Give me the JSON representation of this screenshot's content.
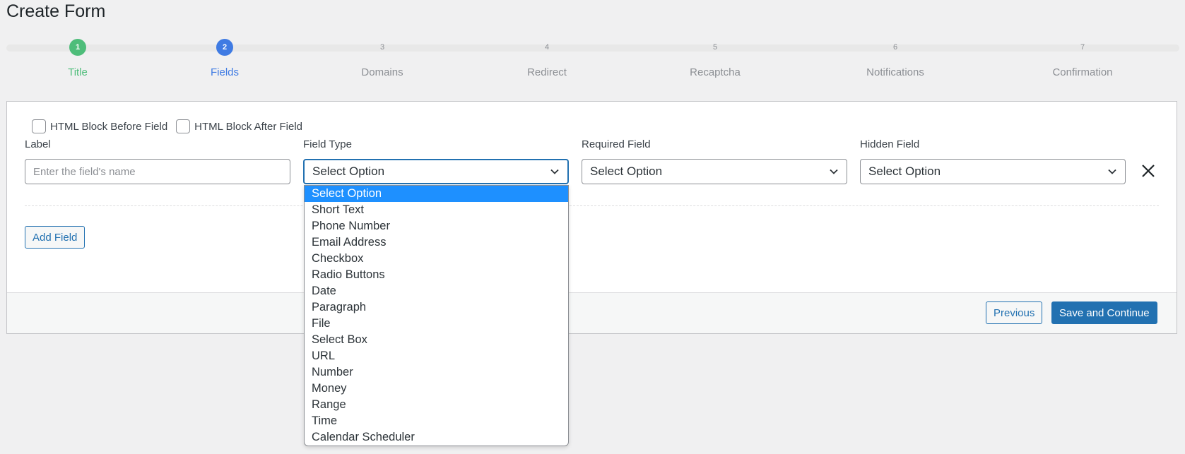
{
  "page": {
    "title": "Create Form"
  },
  "steps": [
    {
      "number": "1",
      "label": "Title",
      "state": "done",
      "color": "#4ebd7a"
    },
    {
      "number": "2",
      "label": "Fields",
      "state": "active",
      "color": "#3f7be3"
    },
    {
      "number": "3",
      "label": "Domains",
      "state": "inactive",
      "color": "#8c8f94"
    },
    {
      "number": "4",
      "label": "Redirect",
      "state": "inactive",
      "color": "#8c8f94"
    },
    {
      "number": "5",
      "label": "Recaptcha",
      "state": "inactive",
      "color": "#8c8f94"
    },
    {
      "number": "6",
      "label": "Notifications",
      "state": "inactive",
      "color": "#8c8f94"
    },
    {
      "number": "7",
      "label": "Confirmation",
      "state": "inactive",
      "color": "#8c8f94"
    }
  ],
  "form": {
    "html_before_label": "HTML Block Before Field",
    "html_after_label": "HTML Block After Field",
    "label_field": {
      "label": "Label",
      "placeholder": "Enter the field's name",
      "value": ""
    },
    "field_type": {
      "label": "Field Type",
      "selected": "Select Option"
    },
    "required_field": {
      "label": "Required Field",
      "selected": "Select Option"
    },
    "hidden_field": {
      "label": "Hidden Field",
      "selected": "Select Option"
    },
    "add_field_label": "Add Field"
  },
  "footer": {
    "previous_label": "Previous",
    "save_label": "Save and Continue"
  },
  "field_type_options": [
    "Select Option",
    "Short Text",
    "Phone Number",
    "Email Address",
    "Checkbox",
    "Radio Buttons",
    "Date",
    "Paragraph",
    "File",
    "Select Box",
    "URL",
    "Number",
    "Money",
    "Range",
    "Time",
    "Calendar Scheduler"
  ],
  "colors": {
    "accent": "#2271b1",
    "done": "#4ebd7a",
    "active": "#3f7be3",
    "highlight": "#1e90ff"
  },
  "icons": {
    "chevron": "chevron-down-icon",
    "close": "close-icon"
  }
}
